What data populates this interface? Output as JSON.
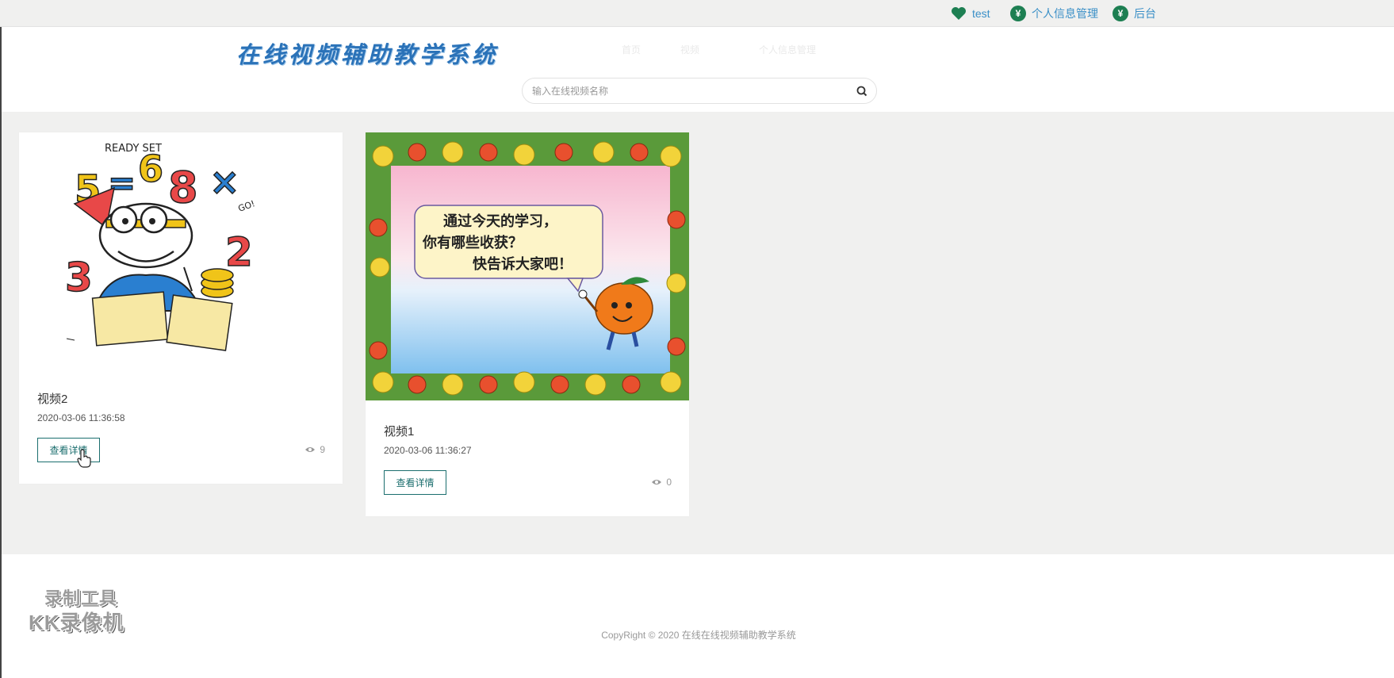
{
  "topbar": {
    "user": "test",
    "profile": "个人信息管理",
    "admin": "后台"
  },
  "header": {
    "logo": "在线视频辅助教学系统",
    "nav": [
      "首页",
      "视频",
      "个人信息管理"
    ],
    "search_placeholder": "输入在线视频名称"
  },
  "videos": [
    {
      "title": "视频2",
      "date": "2020-03-06 11:36:58",
      "button": "查看详情",
      "views": "9"
    },
    {
      "title": "视频1",
      "date": "2020-03-06 11:36:27",
      "button": "查看详情",
      "views": "0"
    }
  ],
  "thumbnail_text": {
    "ready_set": "READY SET",
    "go": "GO!",
    "speech_1": "通过今天的学习，",
    "speech_2": "你有哪些收获？",
    "speech_3": "快告诉大家吧！"
  },
  "footer": {
    "copyright": "CopyRight © 2020 在线在线视频辅助教学系统",
    "watermark_1": "录制工具",
    "watermark_2": "KK录像机"
  },
  "colors": {
    "accent_green": "#1d7f52",
    "link_blue": "#3a8fc7",
    "button_border": "#1b6e6e",
    "logo_blue": "#2a72b8"
  },
  "icons": [
    "heart-icon",
    "yen-icon",
    "search-icon",
    "eye-icon",
    "hand-cursor-icon"
  ]
}
